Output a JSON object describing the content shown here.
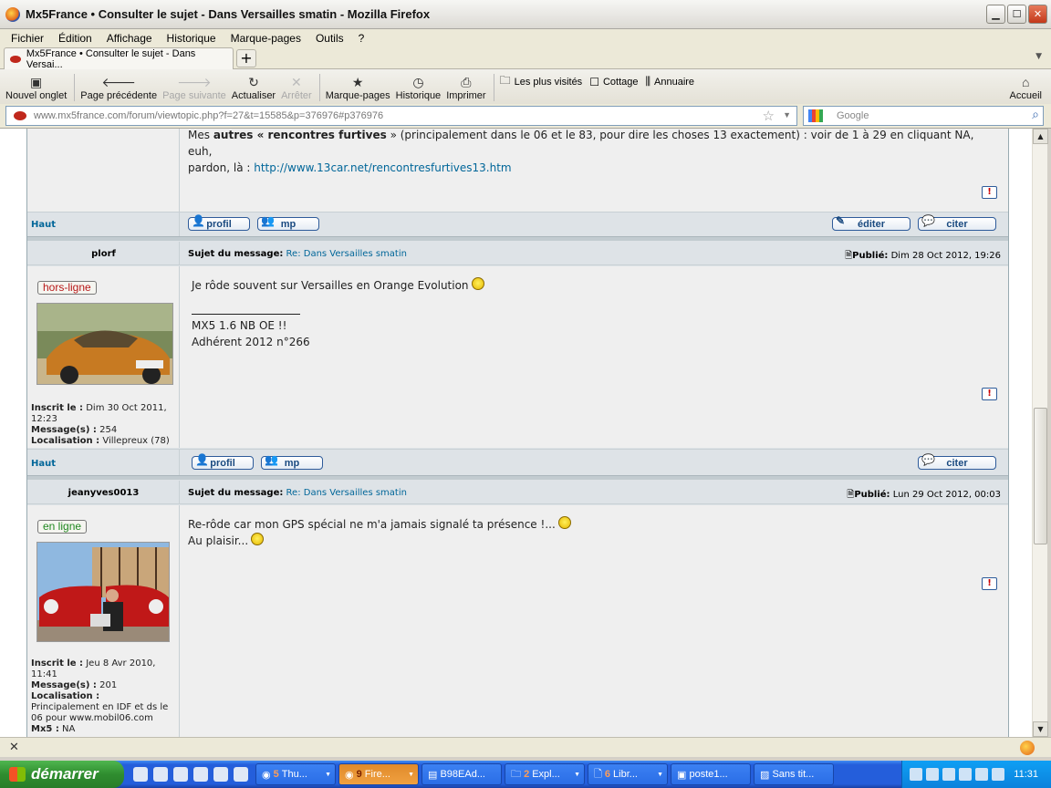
{
  "window": {
    "title": "Mx5France • Consulter le sujet - Dans Versailles smatin - Mozilla Firefox"
  },
  "menu": [
    "Fichier",
    "Édition",
    "Affichage",
    "Historique",
    "Marque-pages",
    "Outils",
    "?"
  ],
  "tab": {
    "label": "Mx5France • Consulter le sujet - Dans Versai..."
  },
  "toolbar": {
    "new_tab": "Nouvel onglet",
    "back": "Page précédente",
    "forward": "Page suivante",
    "reload": "Actualiser",
    "stop": "Arrêter",
    "bookmarks": "Marque-pages",
    "history": "Historique",
    "print": "Imprimer",
    "most_visited": "Les plus visités",
    "cottage": "Cottage",
    "annuaire": "Annuaire",
    "home": "Accueil"
  },
  "address": {
    "url": "www.mx5france.com/forum/viewtopic.php?f=27&t=15585&p=376976#p376976",
    "search_placeholder": "Google"
  },
  "prev_post": {
    "text_pre": "Mes ",
    "bold1": "autres « rencontres furtives",
    "text_mid": " » (principalement dans le 06 et le 83, pour dire les choses 13 exactement) : voir de 1 à 29 en cliquant NA, euh,",
    "text_line2": "pardon, là : ",
    "link": "http://www.13car.net/rencontresfurtives13.htm",
    "haut": "Haut",
    "profil": "profil",
    "mp": "mp",
    "editer": "éditer",
    "citer": "citer"
  },
  "post1": {
    "user": "plorf",
    "subject_label": "Sujet du message:",
    "subject": "Re: Dans Versailles smatin",
    "published_label": "Publié:",
    "date": "Dim 28 Oct 2012, 19:26",
    "status": "hors-ligne",
    "line1": "Je rôde souvent sur Versailles en Orange Evolution",
    "sig1": "MX5 1.6 NB OE !!",
    "sig2": "Adhérent 2012 n°266",
    "inscrit_label": "Inscrit le :",
    "inscrit": "Dim 30 Oct 2011, 12:23",
    "messages_label": "Message(s) :",
    "messages": "254",
    "loc_label": "Localisation :",
    "loc": "Villepreux (78)",
    "haut": "Haut",
    "profil": "profil",
    "mp": "mp",
    "citer": "citer"
  },
  "post2": {
    "user": "jeanyves0013",
    "subject_label": "Sujet du message:",
    "subject": "Re: Dans Versailles smatin",
    "published_label": "Publié:",
    "date": "Lun 29 Oct 2012, 00:03",
    "status": "en ligne",
    "line1": "Re-rôde car mon GPS spécial ne m'a jamais signalé ta présence !...",
    "line2": "Au plaisir...",
    "inscrit_label": "Inscrit le :",
    "inscrit": "Jeu 8 Avr 2010, 11:41",
    "messages_label": "Message(s) :",
    "messages": "201",
    "loc_label": "Localisation :",
    "loc": "Principalement en IDF et ds le 06 pour www.mobil06.com",
    "mx5_label": "Mx5 :",
    "mx5": "NA"
  },
  "taskbar": {
    "start": "démarrer",
    "items": [
      {
        "n": "5",
        "label": "Thu..."
      },
      {
        "n": "9",
        "label": "Fire..."
      },
      {
        "n": "",
        "label": "B98EAd..."
      },
      {
        "n": "2",
        "label": "Expl..."
      },
      {
        "n": "6",
        "label": "Libr..."
      },
      {
        "n": "",
        "label": "poste1..."
      },
      {
        "n": "",
        "label": "Sans tit..."
      }
    ],
    "clock": "11:31"
  }
}
